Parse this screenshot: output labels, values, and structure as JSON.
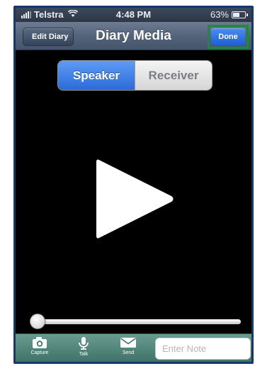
{
  "status_bar": {
    "carrier": "Telstra",
    "time": "4:48 PM",
    "battery": "63%",
    "battery_level": 0.63
  },
  "nav_bar": {
    "back_label": "Edit Diary",
    "title": "Diary Media",
    "done_label": "Done"
  },
  "audio_output": {
    "options": [
      "Speaker",
      "Receiver"
    ],
    "selected": "Speaker"
  },
  "player": {
    "play_icon": "play-icon",
    "progress": 0.0
  },
  "toolbar": {
    "capture_label": "Capture",
    "talk_label": "Talk",
    "send_label": "Send",
    "note_placeholder": "Enter Note",
    "note_value": ""
  },
  "colors": {
    "nav_bar": "#54647b",
    "done_button": "#1e5fd6",
    "done_highlight": "#1b8a3a",
    "segment_selected": "#2b6bd8",
    "toolbar": "#4e8478"
  }
}
